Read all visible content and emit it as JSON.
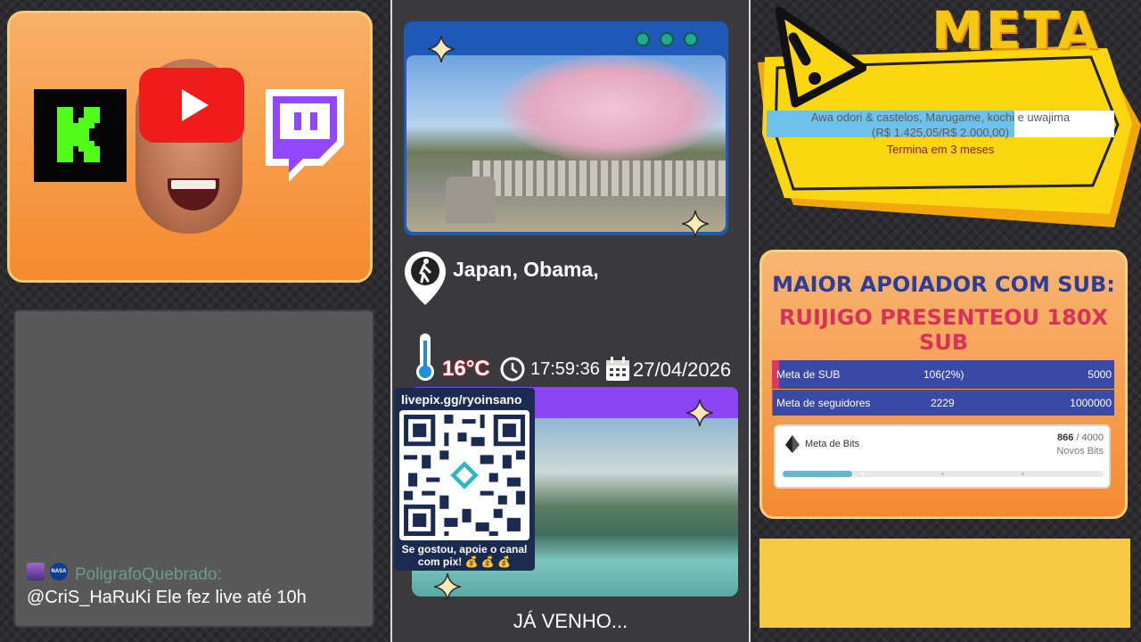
{
  "logos": {
    "kick_letter": "K"
  },
  "chat": {
    "username": "PoligrafoQuebrado:",
    "message": "@CriS_HaRuKi Ele fez live até 10h",
    "badge2_text": "NASA"
  },
  "location": {
    "text": "Japan, Obama,"
  },
  "weather": {
    "temperature": "16°C",
    "time": "17:59:36",
    "date": "27/04/2026"
  },
  "pix": {
    "link": "livepix.gg/ryoinsano",
    "caption_line1": "Se gostou, apoie o canal",
    "caption_line2": "com pix! 💰 💰 💰"
  },
  "status": {
    "brb": "JÁ VENHO..."
  },
  "meta": {
    "title": "META",
    "goal_name": "Awa odori & castelos, Marugame, kochi e uwajima",
    "goal_value": "(R$ 1.425,05/R$ 2.000,00)",
    "progress": 0.7125,
    "ends": "Termina em 3 meses"
  },
  "sub_panel": {
    "title": "MAIOR APOIADOR COM SUB:",
    "subtitle": "RUIJIGO PRESENTEOU 180X SUB",
    "goals": [
      {
        "label": "Meta de SUB",
        "current": "106(2%)",
        "target": "5000",
        "progress": 0.02
      },
      {
        "label": "Meta de seguidores",
        "current": "2229",
        "target": "1000000",
        "progress": 0.002
      }
    ],
    "bits": {
      "label": "Meta de Bits",
      "current": "866",
      "total": "/ 4000",
      "unit": "Novos Bits",
      "progress": 0.2165
    }
  },
  "colors": {
    "accent_blue": "#1f59b7",
    "accent_purple": "#8b45f2",
    "meta_yellow": "#f7c612",
    "sub_red": "#d93a63"
  }
}
